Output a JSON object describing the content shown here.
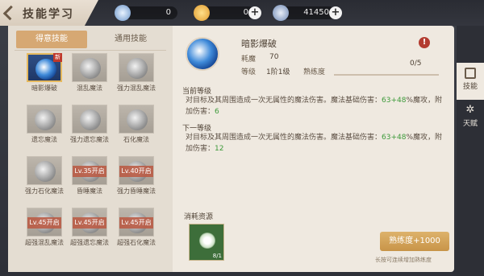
{
  "header": {
    "title": "技能学习",
    "currencies": [
      {
        "icon": "diamond-icon",
        "value": "0",
        "plus": false
      },
      {
        "icon": "gold-coin-icon",
        "value": "0",
        "plus": true
      },
      {
        "icon": "silver-coin-icon",
        "value": "41450",
        "plus": true
      }
    ]
  },
  "tabs": [
    {
      "label": "得意技能",
      "active": true
    },
    {
      "label": "通用技能",
      "active": false
    }
  ],
  "skills": [
    {
      "name": "暗影爆破",
      "lock": "",
      "selected": true,
      "badge": "新"
    },
    {
      "name": "混乱魔法",
      "lock": ""
    },
    {
      "name": "强力混乱魔法",
      "lock": ""
    },
    {
      "name": "遗忘魔法",
      "lock": ""
    },
    {
      "name": "强力遗忘魔法",
      "lock": ""
    },
    {
      "name": "石化魔法",
      "lock": ""
    },
    {
      "name": "强力石化魔法",
      "lock": ""
    },
    {
      "name": "昏睡魔法",
      "lock": "Lv.35开启"
    },
    {
      "name": "强力昏睡魔法",
      "lock": "Lv.40开启"
    },
    {
      "name": "超强混乱魔法",
      "lock": "Lv.45开启"
    },
    {
      "name": "超强遗忘魔法",
      "lock": "Lv.45开启"
    },
    {
      "name": "超强石化魔法",
      "lock": "Lv.45开启"
    }
  ],
  "detail": {
    "name": "暗影爆破",
    "cost_label": "耗魔",
    "cost_value": "70",
    "level_label": "等级",
    "level_value": "1阶1级",
    "proficiency_label": "熟练度",
    "proficiency_value": "0/5",
    "proficiency_fraction": 0,
    "current_title": "当前等级",
    "current_desc_pre": "对目标及其周围造成一次无属性的魔法伤害。魔法基础伤害：",
    "current_desc_green1": "63+48",
    "current_desc_mid": "%魔攻，附加伤害：",
    "current_desc_green2": "6",
    "next_title": "下一等级",
    "next_desc_pre": "对目标及其周围造成一次无属性的魔法伤害。魔法基础伤害：",
    "next_desc_green1": "63+48",
    "next_desc_mid": "%魔攻，附加伤害：",
    "next_desc_green2": "12",
    "resource_title": "消耗资源",
    "resource_count": "8/1",
    "button_label": "熟练度+1000",
    "hint": "长按可连续增加熟练度"
  },
  "sidebar": [
    {
      "label": "技能",
      "icon": "skill-book-icon",
      "active": true
    },
    {
      "label": "天赋",
      "icon": "talent-star-icon",
      "active": false
    }
  ],
  "colors": {
    "accent": "#d6a873",
    "green": "#3d9a3a",
    "warn": "#b33c30"
  }
}
